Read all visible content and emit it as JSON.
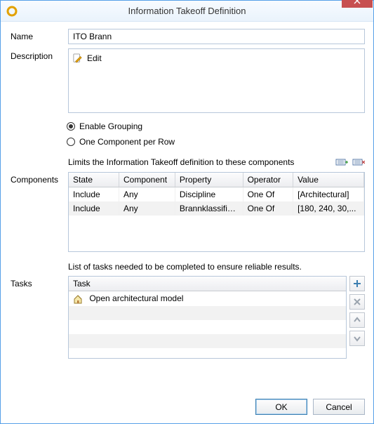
{
  "window": {
    "title": "Information Takeoff Definition"
  },
  "labels": {
    "name": "Name",
    "description": "Description",
    "components": "Components",
    "tasks": "Tasks"
  },
  "name_value": "ITO Brann",
  "description": {
    "edit_label": "Edit"
  },
  "grouping": {
    "enable_label": "Enable Grouping",
    "one_per_row_label": "One Component per Row",
    "selected": "enable"
  },
  "components": {
    "limits_text": "Limits the Information Takeoff definition to these components",
    "columns": {
      "state": "State",
      "component": "Component",
      "property": "Property",
      "operator": "Operator",
      "value": "Value"
    },
    "rows": [
      {
        "state": "Include",
        "component": "Any",
        "property": "Discipline",
        "operator": "One Of",
        "value": "[Architectural]"
      },
      {
        "state": "Include",
        "component": "Any",
        "property": "Brannklassifise...",
        "operator": "One Of",
        "value": "[180, 240, 30,..."
      }
    ]
  },
  "tasks": {
    "intro_text": "List of tasks needed to be completed to ensure reliable results.",
    "column": "Task",
    "rows": [
      {
        "label": "Open architectural model"
      }
    ]
  },
  "buttons": {
    "ok": "OK",
    "cancel": "Cancel"
  }
}
